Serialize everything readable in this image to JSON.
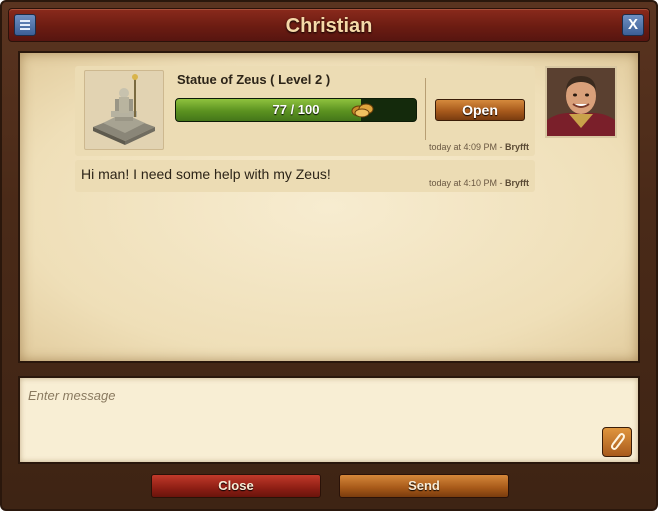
{
  "window": {
    "title": "Christian",
    "close_label": "X"
  },
  "quest_card": {
    "title": "Statue of Zeus ( Level 2 )",
    "progress_text": "77 / 100",
    "progress_fraction": 0.77,
    "open_label": "Open",
    "time": "today at 4:09 PM - ",
    "author": "Bryfft"
  },
  "message": {
    "text": "Hi man! I need some help with my Zeus!",
    "time": "today at 4:10 PM - ",
    "author": "Bryfft"
  },
  "compose": {
    "placeholder": "Enter message"
  },
  "footer": {
    "close_label": "Close",
    "send_label": "Send"
  },
  "colors": {
    "title": "#f6d9a8",
    "progress_green": "#5b9220",
    "accent_orange": "#a85a1c",
    "close_red": "#8e1e14"
  },
  "icons": [
    "menu-icon",
    "close-icon",
    "coins-icon",
    "paperclip-icon"
  ]
}
